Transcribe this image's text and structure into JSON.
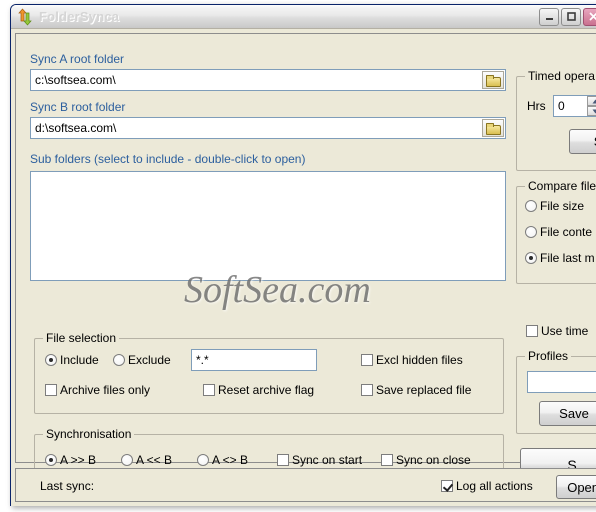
{
  "window": {
    "title": "FolderSynca",
    "icon": "sync-arrows-icon",
    "buttons": {
      "minimize": "–",
      "maximize": "❐",
      "close": "✕"
    }
  },
  "main": {
    "sync_a_label": "Sync A root folder",
    "sync_a_value": "c:\\softsea.com\\",
    "sync_b_label": "Sync B root folder",
    "sync_b_value": "d:\\softsea.com\\",
    "subfolders_label": "Sub folders (select to include  - double-click to open)",
    "subfolders_items": [],
    "browse_icon": "folder-icon",
    "watermark": "SoftSea.com"
  },
  "file_selection": {
    "title": "File selection",
    "include_label": "Include",
    "exclude_label": "Exclude",
    "include_selected": true,
    "mask_value": "*.*",
    "excl_hidden_label": "Excl hidden files",
    "excl_hidden_checked": false,
    "archive_only_label": "Archive files only",
    "archive_only_checked": false,
    "reset_archive_label": "Reset archive flag",
    "reset_archive_checked": false,
    "save_replaced_label": "Save replaced file",
    "save_replaced_checked": false
  },
  "synchronisation": {
    "title": "Synchronisation",
    "a_to_b_label": "A >> B",
    "b_to_a_label": "A << B",
    "both_label": "A <> B",
    "direction_selected": "a_to_b",
    "sync_on_start_label": "Sync on start",
    "sync_on_start_checked": false,
    "sync_on_close_label": "Sync on close",
    "sync_on_close_checked": false
  },
  "timed": {
    "title": "Timed opera",
    "hrs_label": "Hrs",
    "hrs_value": "0",
    "start_button": "ST"
  },
  "compare": {
    "title": "Compare file",
    "file_size_label": "File size",
    "file_contents_label": "File conte",
    "file_last_modified_label": "File last m",
    "selected": "file_last_modified",
    "use_time_label": "Use time",
    "use_time_checked": false
  },
  "profiles": {
    "title": "Profiles",
    "name_value": "",
    "save_button": "Save"
  },
  "sync_button": {
    "label": "S"
  },
  "statusbar": {
    "last_sync_label": "Last sync:",
    "log_all_label": "Log all actions",
    "log_all_checked": true,
    "open_log_button": "Open lo"
  }
}
